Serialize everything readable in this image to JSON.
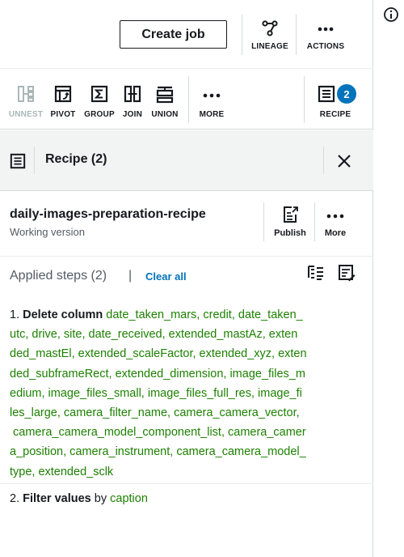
{
  "topbar": {
    "create_job_label": "Create job",
    "lineage_label": "LINEAGE",
    "actions_label": "ACTIONS"
  },
  "toolbar": {
    "unnest_label": "UNNEST",
    "pivot_label": "PIVOT",
    "group_label": "GROUP",
    "join_label": "JOIN",
    "union_label": "UNION",
    "more_label": "MORE",
    "recipe_label": "RECIPE",
    "recipe_badge": "2"
  },
  "recipe_panel": {
    "title": "Recipe (2)",
    "recipe_name": "daily-images-preparation-recipe",
    "version": "Working version",
    "publish_label": "Publish",
    "more_label": "More",
    "applied_steps_title": "Applied steps (2)",
    "separator": "|",
    "clear_all_label": "Clear all"
  },
  "steps": [
    {
      "number": "1.",
      "action": "Delete column",
      "lines": [
        "date_taken_mars, credit, date_taken_",
        "utc, drive, site, date_received, extended_mastAz, exten",
        "ded_mastEl, extended_scaleFactor, extended_xyz, exten",
        "ded_subframeRect, extended_dimension, image_files_m",
        "edium, image_files_small, image_files_full_res, image_fi",
        "les_large, camera_filter_name, camera_camera_vector,",
        " camera_camera_model_component_list, camera_camer",
        "a_position, camera_instrument, camera_camera_model_",
        "type, extended_sclk"
      ]
    },
    {
      "number": "2.",
      "action": "Filter values",
      "connector": "by",
      "column": "caption"
    }
  ],
  "colors": {
    "accent_blue": "#0073bb",
    "column_green": "#1d8102",
    "text": "#16191f",
    "muted": "#545b64"
  }
}
